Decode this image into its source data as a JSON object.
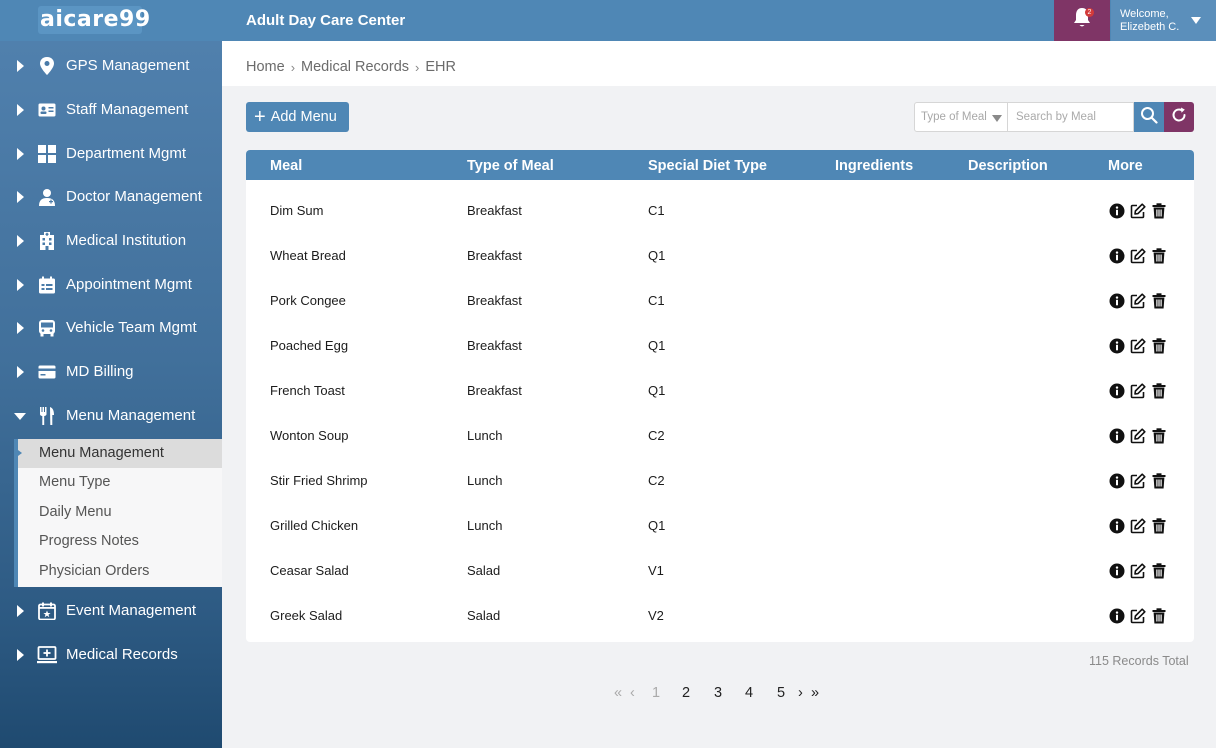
{
  "header": {
    "logo_text": "aicare99",
    "app_title": "Adult Day Care Center",
    "notification_count": "2",
    "welcome": "Welcome,",
    "user_name": "Elizebeth C."
  },
  "sidebar": {
    "items": [
      {
        "label": "GPS Management",
        "icon": "map-pin-icon"
      },
      {
        "label": "Staff Management",
        "icon": "id-card-icon"
      },
      {
        "label": "Department Mgmt",
        "icon": "grid-icon"
      },
      {
        "label": "Doctor Management",
        "icon": "doctor-icon"
      },
      {
        "label": "Medical Institution",
        "icon": "hospital-icon"
      },
      {
        "label": "Appointment Mgmt",
        "icon": "calendar-icon"
      },
      {
        "label": "Vehicle Team Mgmt",
        "icon": "bus-icon"
      },
      {
        "label": "MD Billing",
        "icon": "credit-card-icon"
      },
      {
        "label": "Menu Management",
        "icon": "utensils-icon"
      },
      {
        "label": "Event Management",
        "icon": "calendar-star-icon"
      },
      {
        "label": "Medical Records",
        "icon": "monitor-plus-icon"
      }
    ],
    "submenu": [
      "Menu Management",
      "Menu Type",
      "Daily Menu",
      "Progress Notes",
      "Physician Orders"
    ]
  },
  "breadcrumb": [
    "Home",
    "Medical Records",
    "EHR"
  ],
  "toolbar": {
    "add_label": "Add Menu",
    "type_placeholder": "Type of Meal",
    "search_placeholder": "Search by Meal"
  },
  "table": {
    "columns": [
      "Meal",
      "Type of Meal",
      "Special Diet Type",
      "Ingredients",
      "Description",
      "More"
    ],
    "rows": [
      {
        "meal": "Dim Sum",
        "type": "Breakfast",
        "diet": "C1",
        "ingredients": "",
        "description": ""
      },
      {
        "meal": "Wheat Bread",
        "type": "Breakfast",
        "diet": "Q1",
        "ingredients": "",
        "description": ""
      },
      {
        "meal": "Pork Congee",
        "type": "Breakfast",
        "diet": "C1",
        "ingredients": "",
        "description": ""
      },
      {
        "meal": "Poached Egg",
        "type": "Breakfast",
        "diet": "Q1",
        "ingredients": "",
        "description": ""
      },
      {
        "meal": "French Toast",
        "type": "Breakfast",
        "diet": "Q1",
        "ingredients": "",
        "description": ""
      },
      {
        "meal": "Wonton Soup",
        "type": "Lunch",
        "diet": "C2",
        "ingredients": "",
        "description": ""
      },
      {
        "meal": "Stir Fried Shrimp",
        "type": "Lunch",
        "diet": "C2",
        "ingredients": "",
        "description": ""
      },
      {
        "meal": "Grilled Chicken",
        "type": "Lunch",
        "diet": "Q1",
        "ingredients": "",
        "description": ""
      },
      {
        "meal": "Ceasar Salad",
        "type": "Salad",
        "diet": "V1",
        "ingredients": "",
        "description": ""
      },
      {
        "meal": "Greek Salad",
        "type": "Salad",
        "diet": "V2",
        "ingredients": "",
        "description": ""
      }
    ]
  },
  "footer": {
    "total": "115 Records Total",
    "pages": [
      "1",
      "2",
      "3",
      "4",
      "5"
    ]
  },
  "colors": {
    "primary": "#4f87b5",
    "accent": "#7f3566"
  }
}
